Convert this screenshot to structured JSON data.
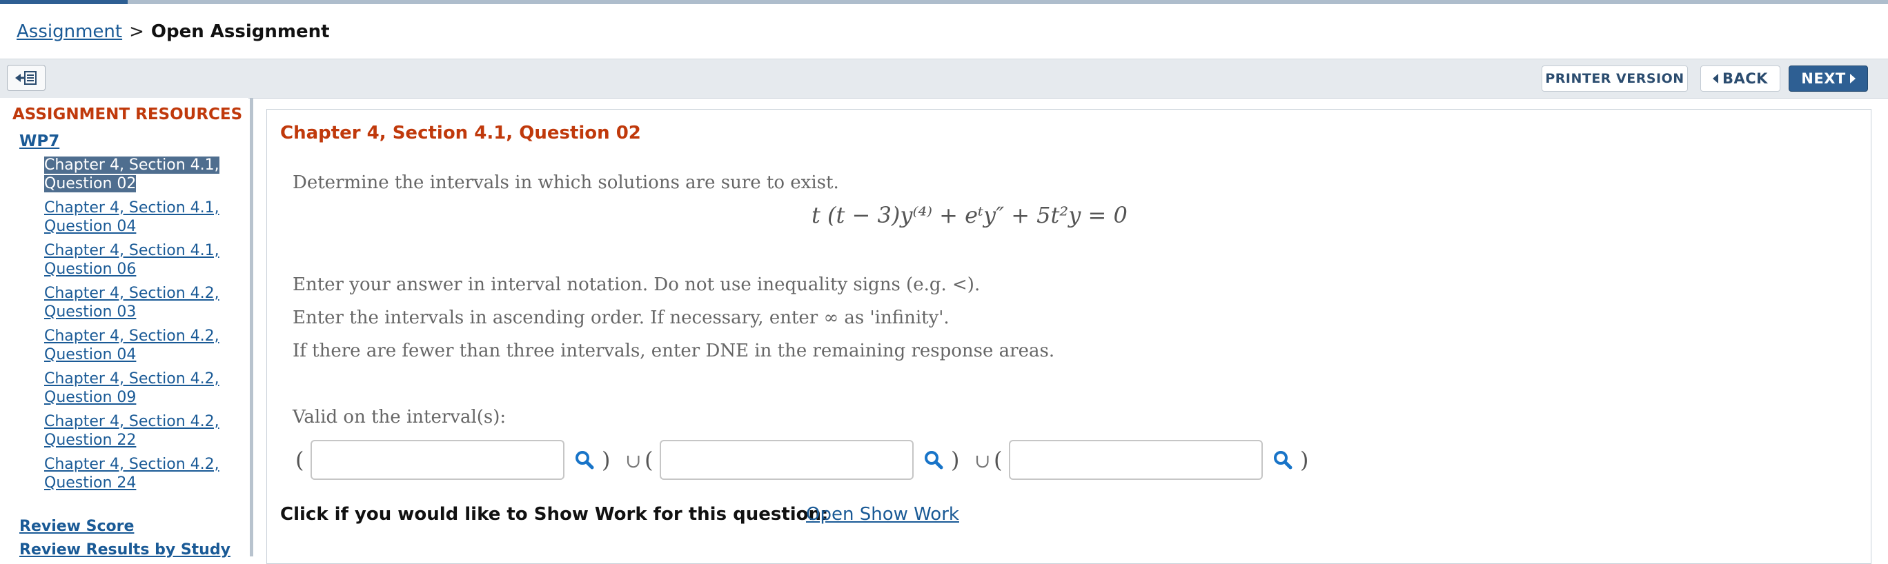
{
  "breadcrumb": {
    "parent": "Assignment",
    "separator": ">",
    "current": "Open Assignment"
  },
  "toolbar": {
    "printer_label": "PRINTER VERSION",
    "back_label": "BACK",
    "next_label": "NEXT"
  },
  "sidebar": {
    "title": "ASSIGNMENT RESOURCES",
    "group": "WP7",
    "items": [
      {
        "label": "Chapter 4, Section 4.1, Question 02",
        "active": true
      },
      {
        "label": "Chapter 4, Section 4.1, Question 04"
      },
      {
        "label": "Chapter 4, Section 4.1, Question 06"
      },
      {
        "label": "Chapter 4, Section 4.2, Question 03"
      },
      {
        "label": "Chapter 4, Section 4.2, Question 04"
      },
      {
        "label": "Chapter 4, Section 4.2, Question 09"
      },
      {
        "label": "Chapter 4, Section 4.2, Question 22"
      },
      {
        "label": "Chapter 4, Section 4.2, Question 24"
      }
    ],
    "review_score": "Review Score",
    "review_results": "Review Results by Study"
  },
  "question": {
    "title": "Chapter 4, Section 4.1, Question 02",
    "prompt": "Determine the intervals in which solutions are sure to exist.",
    "equation": "t (t − 3)y⁽⁴⁾ + eᵗy″ + 5t²y = 0",
    "instruction1": "Enter your answer in interval notation. Do not use inequality signs (e.g. <).",
    "instruction2": "Enter the intervals in ascending order. If necessary, enter ∞ as 'infinity'.",
    "instruction3": "If there are fewer than three intervals, enter DNE in the remaining response areas.",
    "valid_label": "Valid on the interval(s):",
    "open_paren": "(",
    "close_paren": ")",
    "union": "∪",
    "inputs": [
      "",
      "",
      ""
    ]
  },
  "show_work": {
    "label": "Click if you would like to Show Work for this question:",
    "link": "Open Show Work"
  },
  "colors": {
    "accent": "#c0390b",
    "link": "#1a5a96",
    "primary_button": "#2e5f93"
  },
  "icons": {
    "collapse": "collapse-sidebar-icon",
    "search": "search-icon"
  }
}
